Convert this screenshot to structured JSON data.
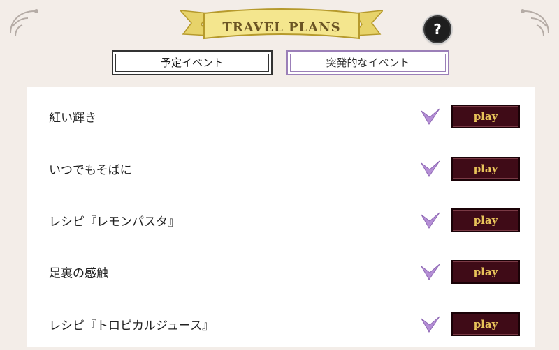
{
  "header": {
    "title": "TRAVEL PLANS",
    "help_label": "?"
  },
  "tabs": [
    {
      "label": "予定イベント",
      "active": false
    },
    {
      "label": "突発的なイベント",
      "active": true
    }
  ],
  "events": [
    {
      "title": "紅い輝き",
      "completed": true,
      "action_label": "play"
    },
    {
      "title": "いつでもそばに",
      "completed": true,
      "action_label": "play"
    },
    {
      "title": "レシピ『レモンパスタ』",
      "completed": true,
      "action_label": "play"
    },
    {
      "title": "足裏の感触",
      "completed": true,
      "action_label": "play"
    },
    {
      "title": "レシピ『トロピカルジュース』",
      "completed": true,
      "action_label": "play"
    }
  ],
  "colors": {
    "background": "#f3ede8",
    "banner": "#f2e48a",
    "check": "#b58fd6",
    "play_button": "#3f0b17",
    "play_text": "#e8c35a",
    "active_tab_border": "#9b7fb8"
  }
}
